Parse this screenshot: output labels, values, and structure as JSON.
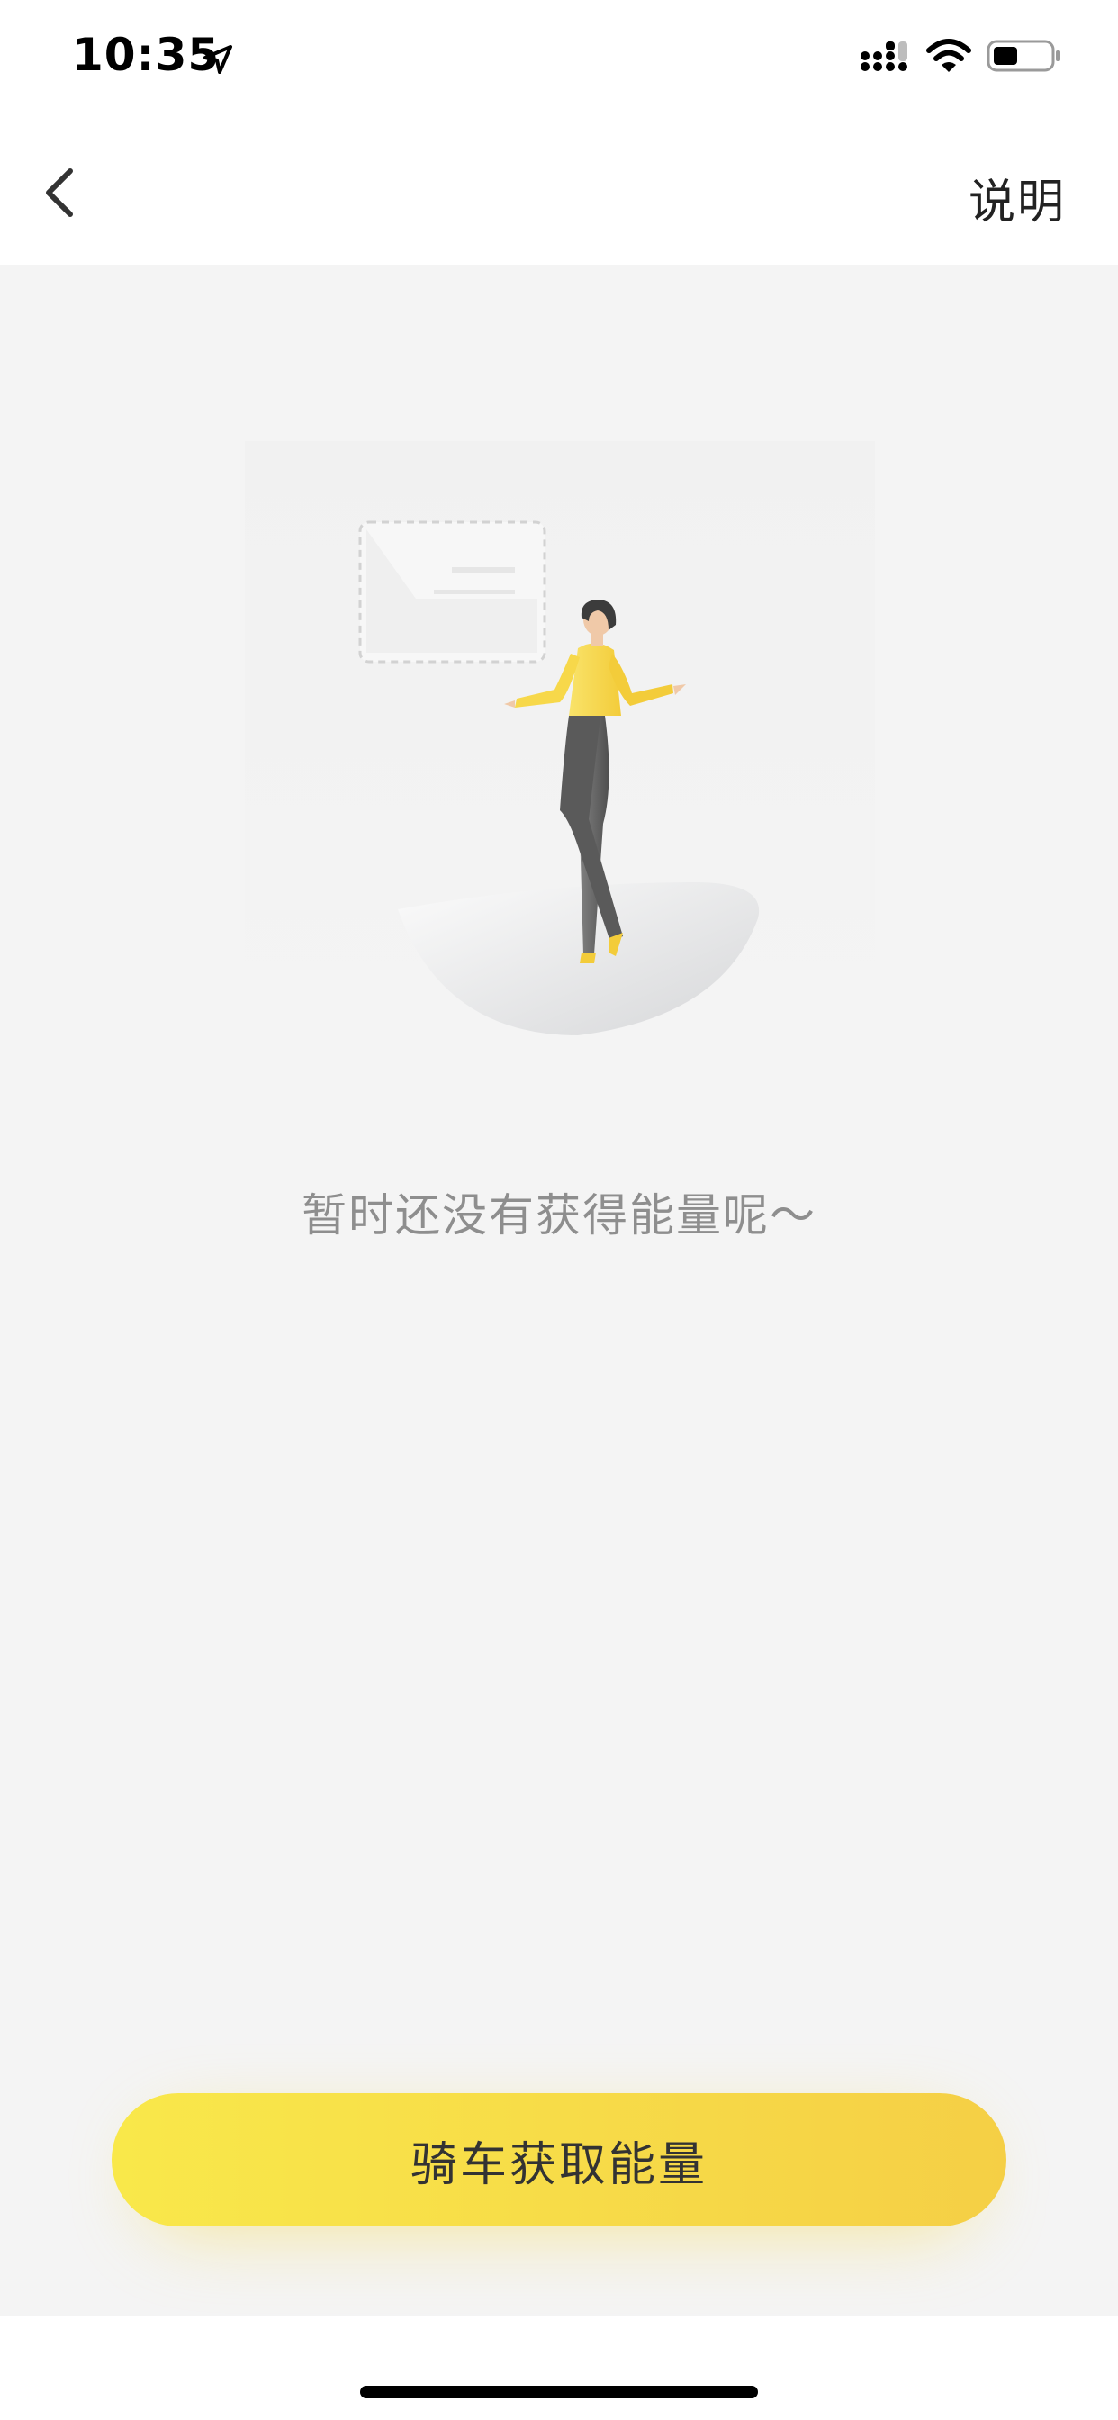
{
  "status_bar": {
    "time": "10:35",
    "icons": [
      "location-arrow-icon",
      "signal-icon",
      "wifi-icon",
      "battery-icon"
    ]
  },
  "nav": {
    "back_icon": "chevron-left-icon",
    "help_label": "说明"
  },
  "empty_state": {
    "illustration": "person-standing-illustration",
    "message": "暂时还没有获得能量呢～"
  },
  "cta": {
    "label": "骑车获取能量"
  },
  "colors": {
    "background": "#f4f4f4",
    "cta_start": "#f9e84a",
    "cta_end": "#f5cf45",
    "accent_yellow": "#f6d23f"
  }
}
